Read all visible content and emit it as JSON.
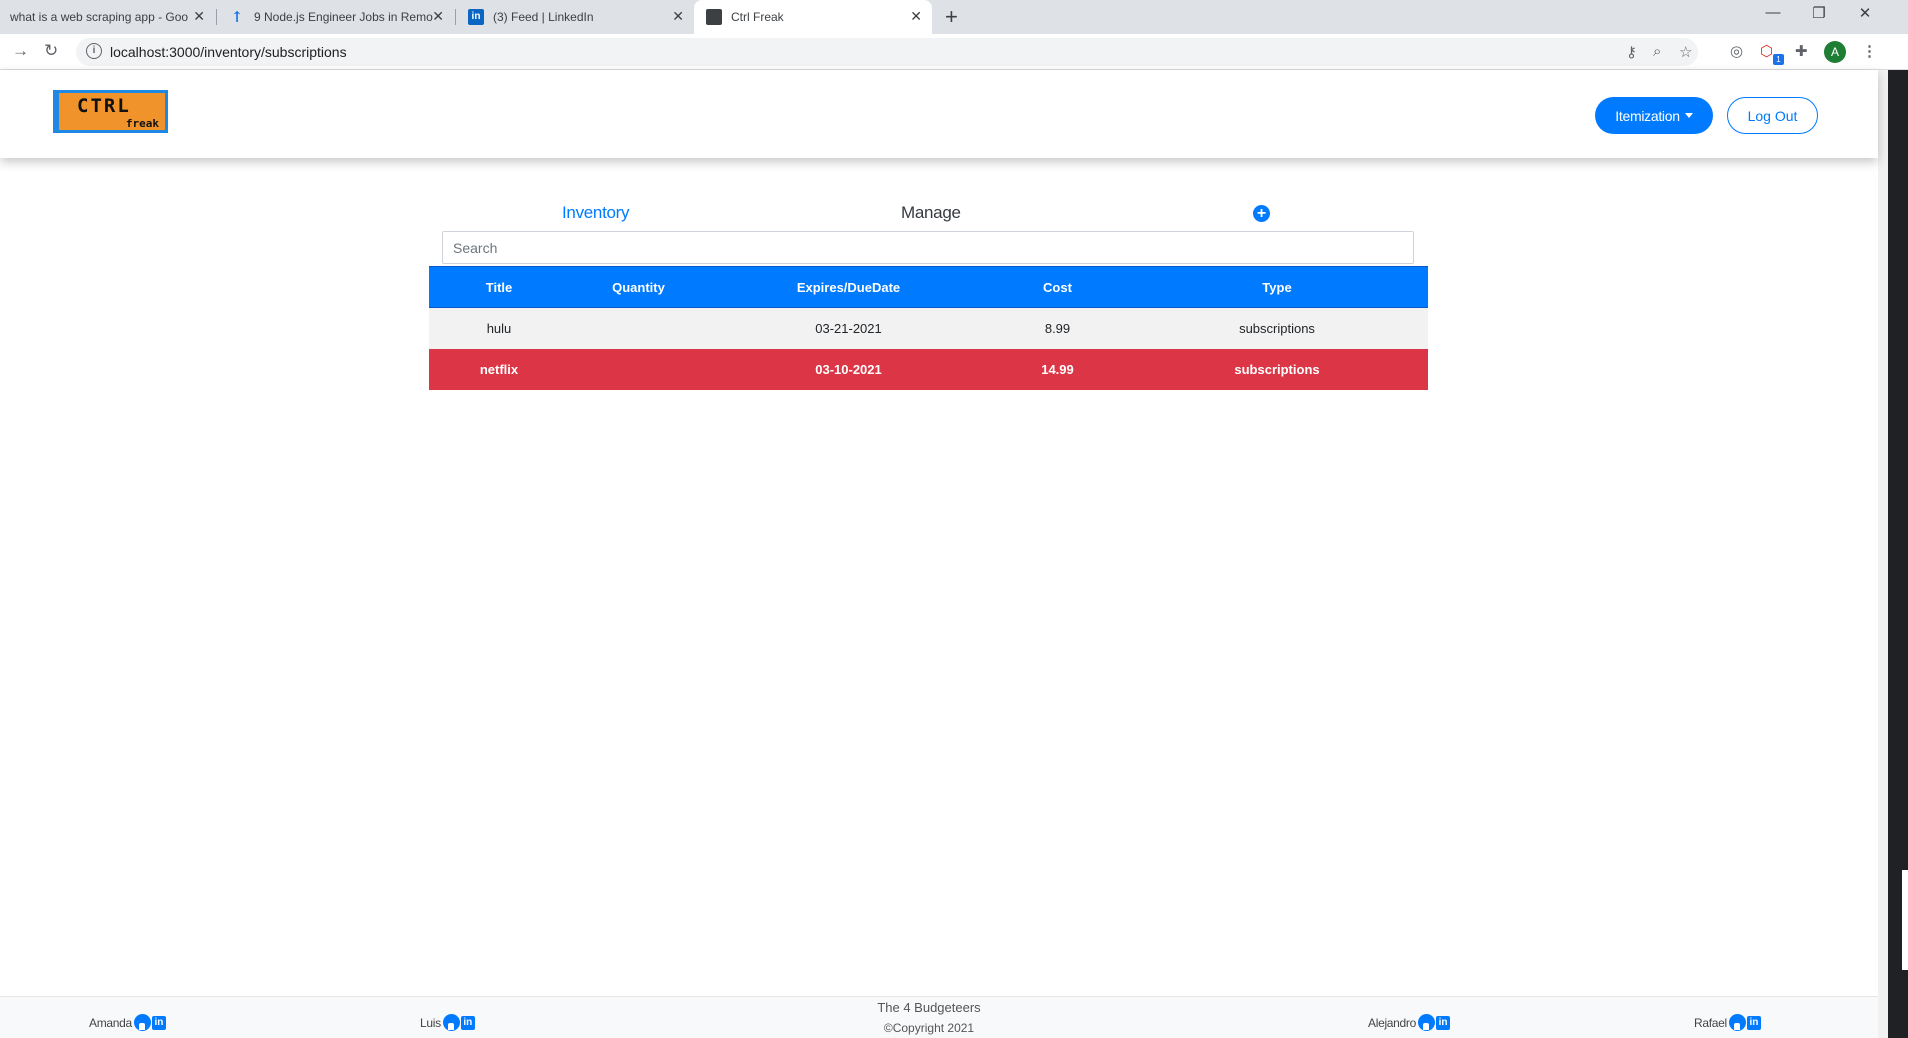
{
  "browser": {
    "tabs": [
      {
        "title": "what is a web scraping app - Goo",
        "favicon": "google-icon"
      },
      {
        "title": "9 Node.js Engineer Jobs in Remo",
        "favicon": "microsoft-icon"
      },
      {
        "title": "(3) Feed | LinkedIn",
        "favicon": "linkedin-icon"
      },
      {
        "title": "Ctrl Freak",
        "favicon": "page-icon"
      }
    ],
    "url": "localhost:3000/inventory/subscriptions",
    "profile_initial": "A",
    "extension_badge": "1"
  },
  "navbar": {
    "logo_top": "CTRL",
    "logo_bottom": "freak",
    "itemization_label": "Itemization",
    "logout_label": "Log Out"
  },
  "subnav": {
    "inventory_label": "Inventory",
    "manage_label": "Manage",
    "add_icon": "plus-circle-icon"
  },
  "search": {
    "placeholder": "Search"
  },
  "table": {
    "headers": [
      "Title",
      "Quantity",
      "Expires/DueDate",
      "Cost",
      "Type"
    ],
    "rows": [
      {
        "title": "hulu",
        "quantity": "",
        "due": "03-21-2021",
        "cost": "8.99",
        "type": "subscriptions",
        "status": "normal"
      },
      {
        "title": "netflix",
        "quantity": "",
        "due": "03-10-2021",
        "cost": "14.99",
        "type": "subscriptions",
        "status": "danger"
      }
    ]
  },
  "footer": {
    "members": [
      "Amanda",
      "Luis",
      "Alejandro",
      "Rafael"
    ],
    "team": "The 4 Budgeteers",
    "copyright": "©Copyright 2021"
  },
  "colors": {
    "primary": "#007bff",
    "danger": "#dc3545",
    "logo_orange": "#f0932b"
  }
}
